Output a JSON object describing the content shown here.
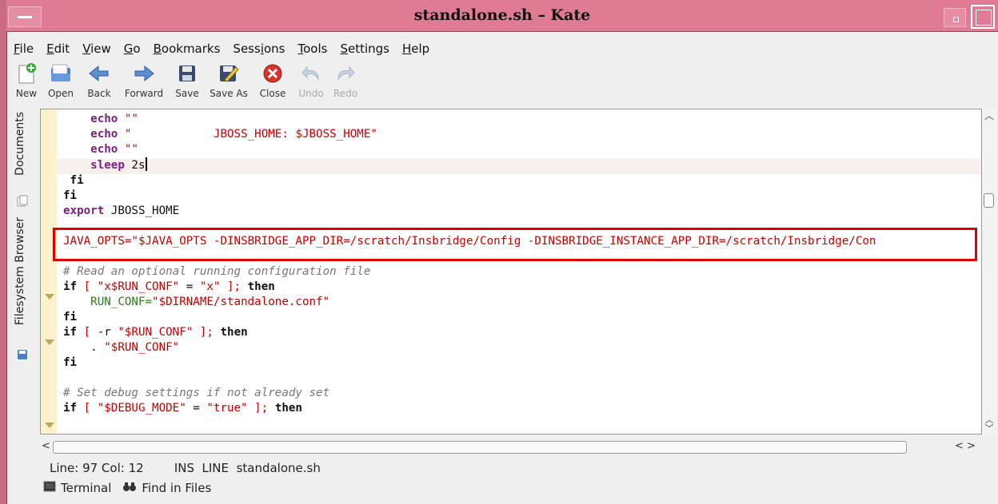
{
  "window": {
    "title": "standalone.sh – Kate"
  },
  "menu": [
    {
      "label": "File",
      "ul": "F",
      "rest": "ile"
    },
    {
      "label": "Edit",
      "ul": "E",
      "rest": "dit"
    },
    {
      "label": "View",
      "ul": "V",
      "rest": "iew"
    },
    {
      "label": "Go",
      "ul": "G",
      "rest": "o"
    },
    {
      "label": "Bookmarks",
      "ul": "B",
      "rest": "ookmarks"
    },
    {
      "label": "Sessions",
      "pre": "Sess",
      "ul": "i",
      "rest": "ons"
    },
    {
      "label": "Tools",
      "ul": "T",
      "rest": "ools"
    },
    {
      "label": "Settings",
      "ul": "S",
      "rest": "ettings"
    },
    {
      "label": "Help",
      "ul": "H",
      "rest": "elp"
    }
  ],
  "toolbar": {
    "new": "New",
    "open": "Open",
    "back": "Back",
    "forward": "Forward",
    "save": "Save",
    "save_as": "Save As",
    "close": "Close",
    "undo": "Undo",
    "redo": "Redo"
  },
  "side_tabs": {
    "documents": "Documents",
    "filesystem": "Filesystem Browser"
  },
  "code": {
    "l1_cmd": "echo",
    "l1_str": "\"\"",
    "l2_cmd": "echo",
    "l2_str1": "\"            JBOSS_HOME: ",
    "l2_var": "$JBOSS_HOME",
    "l2_str2": "\"",
    "l3_cmd": "echo",
    "l3_str": "\"\"",
    "l4_cmd": "sleep",
    "l4_arg": " 2s",
    "l5": " fi",
    "l6": "fi",
    "l7_kw": "export",
    "l7_rest": " JBOSS_HOME",
    "java_opts": "JAVA_OPTS=\"$JAVA_OPTS -DINSBRIDGE_APP_DIR=/scratch/Insbridge/Config -DINSBRIDGE_INSTANCE_APP_DIR=/scratch/Insbridge/Con",
    "c1": "# Read an optional running configuration file",
    "if1_kw": "if",
    "if1_a": " [ ",
    "if1_s1": "\"x$RUN_CONF\"",
    "if1_eq": " = ",
    "if1_s2": "\"x\"",
    "if1_b": " ]; ",
    "if1_then": "then",
    "rc_a": "RUN_CONF=",
    "rc_s": "\"$DIRNAME",
    "rc_s2": "/standalone.conf\"",
    "fi1": "fi",
    "if2_kw": "if",
    "if2_a": " [ ",
    "if2_opt": "-r",
    "if2_s": " \"$RUN_CONF\"",
    "if2_b": " ]; ",
    "if2_then": "then",
    "dot_a": ". ",
    "dot_s": "\"$RUN_CONF\"",
    "fi2": "fi",
    "c2": "# Set debug settings if not already set",
    "if3_kw": "if",
    "if3_a": " [ ",
    "if3_s1": "\"$DEBUG_MODE\"",
    "if3_eq": " = ",
    "if3_s2": "\"true\"",
    "if3_b": " ]; ",
    "if3_then": "then"
  },
  "status": {
    "line": "Line: 97 Col: 12",
    "mode": "INS  LINE",
    "file": "standalone.sh"
  },
  "bottom": {
    "terminal": "Terminal",
    "find": "Find in Files"
  },
  "colors": {
    "titlebar": "#e07b94",
    "highlight_box": "#e00000"
  }
}
